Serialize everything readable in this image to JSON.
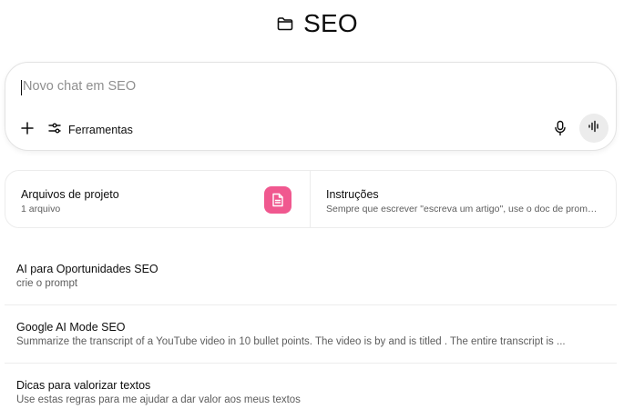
{
  "header": {
    "icon": "folder-icon",
    "title": "SEO"
  },
  "composer": {
    "placeholder": "Novo chat em SEO",
    "tools_label": "Ferramentas",
    "icons": [
      "plus-icon",
      "sliders-icon",
      "mic-icon",
      "voice-waveform-icon"
    ]
  },
  "cards": {
    "files": {
      "title": "Arquivos de projeto",
      "subtitle": "1 arquivo",
      "icon": "document-icon",
      "icon_color": "#f0588f"
    },
    "instructions": {
      "title": "Instruções",
      "subtitle": "Sempre que escrever \"escreva um artigo\", use o doc de promp..."
    }
  },
  "chats": [
    {
      "title": "AI para Oportunidades SEO",
      "subtitle": "crie o prompt"
    },
    {
      "title": "Google AI Mode SEO",
      "subtitle": "Summarize the transcript of a YouTube video in 10 bullet points. The video is by and is titled . The entire transcript is ..."
    },
    {
      "title": "Dicas para valorizar textos",
      "subtitle": "Use estas regras para me ajudar a dar valor aos meus textos"
    }
  ]
}
